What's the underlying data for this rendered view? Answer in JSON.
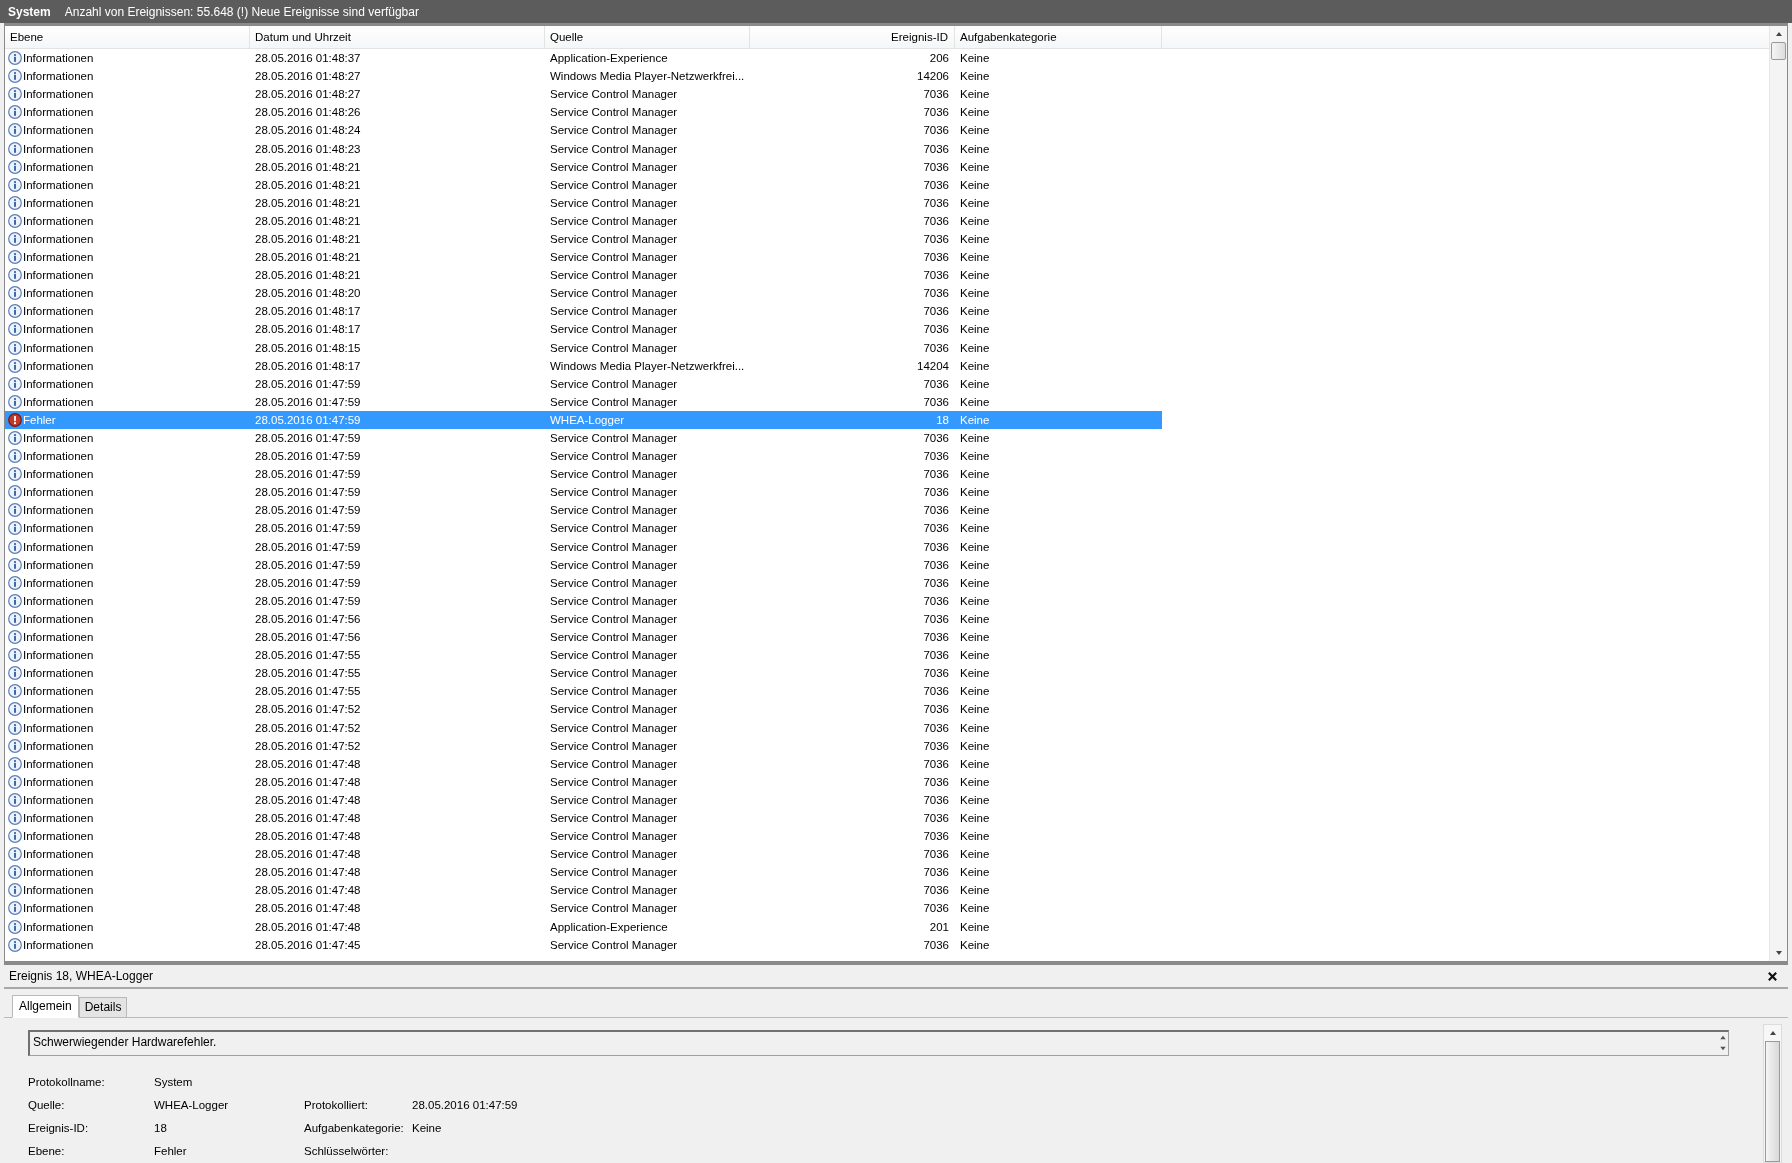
{
  "title_bar": {
    "log_name": "System",
    "status": "Anzahl von Ereignissen: 55.648 (!) Neue Ereignisse sind verfügbar"
  },
  "table": {
    "columns": [
      "Ebene",
      "Datum und Uhrzeit",
      "Quelle",
      "Ereignis-ID",
      "Aufgabenkategorie"
    ],
    "rows": [
      {
        "kind": "info",
        "ebene": "Informationen",
        "date": "28.05.2016 01:48:37",
        "source": "Application-Experience",
        "id": "206",
        "category": "Keine",
        "selected": false
      },
      {
        "kind": "info",
        "ebene": "Informationen",
        "date": "28.05.2016 01:48:27",
        "source": "Windows Media Player-Netzwerkfrei...",
        "id": "14206",
        "category": "Keine",
        "selected": false
      },
      {
        "kind": "info",
        "ebene": "Informationen",
        "date": "28.05.2016 01:48:27",
        "source": "Service Control Manager",
        "id": "7036",
        "category": "Keine",
        "selected": false
      },
      {
        "kind": "info",
        "ebene": "Informationen",
        "date": "28.05.2016 01:48:26",
        "source": "Service Control Manager",
        "id": "7036",
        "category": "Keine",
        "selected": false
      },
      {
        "kind": "info",
        "ebene": "Informationen",
        "date": "28.05.2016 01:48:24",
        "source": "Service Control Manager",
        "id": "7036",
        "category": "Keine",
        "selected": false
      },
      {
        "kind": "info",
        "ebene": "Informationen",
        "date": "28.05.2016 01:48:23",
        "source": "Service Control Manager",
        "id": "7036",
        "category": "Keine",
        "selected": false
      },
      {
        "kind": "info",
        "ebene": "Informationen",
        "date": "28.05.2016 01:48:21",
        "source": "Service Control Manager",
        "id": "7036",
        "category": "Keine",
        "selected": false
      },
      {
        "kind": "info",
        "ebene": "Informationen",
        "date": "28.05.2016 01:48:21",
        "source": "Service Control Manager",
        "id": "7036",
        "category": "Keine",
        "selected": false
      },
      {
        "kind": "info",
        "ebene": "Informationen",
        "date": "28.05.2016 01:48:21",
        "source": "Service Control Manager",
        "id": "7036",
        "category": "Keine",
        "selected": false
      },
      {
        "kind": "info",
        "ebene": "Informationen",
        "date": "28.05.2016 01:48:21",
        "source": "Service Control Manager",
        "id": "7036",
        "category": "Keine",
        "selected": false
      },
      {
        "kind": "info",
        "ebene": "Informationen",
        "date": "28.05.2016 01:48:21",
        "source": "Service Control Manager",
        "id": "7036",
        "category": "Keine",
        "selected": false
      },
      {
        "kind": "info",
        "ebene": "Informationen",
        "date": "28.05.2016 01:48:21",
        "source": "Service Control Manager",
        "id": "7036",
        "category": "Keine",
        "selected": false
      },
      {
        "kind": "info",
        "ebene": "Informationen",
        "date": "28.05.2016 01:48:21",
        "source": "Service Control Manager",
        "id": "7036",
        "category": "Keine",
        "selected": false
      },
      {
        "kind": "info",
        "ebene": "Informationen",
        "date": "28.05.2016 01:48:20",
        "source": "Service Control Manager",
        "id": "7036",
        "category": "Keine",
        "selected": false
      },
      {
        "kind": "info",
        "ebene": "Informationen",
        "date": "28.05.2016 01:48:17",
        "source": "Service Control Manager",
        "id": "7036",
        "category": "Keine",
        "selected": false
      },
      {
        "kind": "info",
        "ebene": "Informationen",
        "date": "28.05.2016 01:48:17",
        "source": "Service Control Manager",
        "id": "7036",
        "category": "Keine",
        "selected": false
      },
      {
        "kind": "info",
        "ebene": "Informationen",
        "date": "28.05.2016 01:48:15",
        "source": "Service Control Manager",
        "id": "7036",
        "category": "Keine",
        "selected": false
      },
      {
        "kind": "info",
        "ebene": "Informationen",
        "date": "28.05.2016 01:48:17",
        "source": "Windows Media Player-Netzwerkfrei...",
        "id": "14204",
        "category": "Keine",
        "selected": false
      },
      {
        "kind": "info",
        "ebene": "Informationen",
        "date": "28.05.2016 01:47:59",
        "source": "Service Control Manager",
        "id": "7036",
        "category": "Keine",
        "selected": false
      },
      {
        "kind": "info",
        "ebene": "Informationen",
        "date": "28.05.2016 01:47:59",
        "source": "Service Control Manager",
        "id": "7036",
        "category": "Keine",
        "selected": false
      },
      {
        "kind": "error",
        "ebene": "Fehler",
        "date": "28.05.2016 01:47:59",
        "source": "WHEA-Logger",
        "id": "18",
        "category": "Keine",
        "selected": true
      },
      {
        "kind": "info",
        "ebene": "Informationen",
        "date": "28.05.2016 01:47:59",
        "source": "Service Control Manager",
        "id": "7036",
        "category": "Keine",
        "selected": false
      },
      {
        "kind": "info",
        "ebene": "Informationen",
        "date": "28.05.2016 01:47:59",
        "source": "Service Control Manager",
        "id": "7036",
        "category": "Keine",
        "selected": false
      },
      {
        "kind": "info",
        "ebene": "Informationen",
        "date": "28.05.2016 01:47:59",
        "source": "Service Control Manager",
        "id": "7036",
        "category": "Keine",
        "selected": false
      },
      {
        "kind": "info",
        "ebene": "Informationen",
        "date": "28.05.2016 01:47:59",
        "source": "Service Control Manager",
        "id": "7036",
        "category": "Keine",
        "selected": false
      },
      {
        "kind": "info",
        "ebene": "Informationen",
        "date": "28.05.2016 01:47:59",
        "source": "Service Control Manager",
        "id": "7036",
        "category": "Keine",
        "selected": false
      },
      {
        "kind": "info",
        "ebene": "Informationen",
        "date": "28.05.2016 01:47:59",
        "source": "Service Control Manager",
        "id": "7036",
        "category": "Keine",
        "selected": false
      },
      {
        "kind": "info",
        "ebene": "Informationen",
        "date": "28.05.2016 01:47:59",
        "source": "Service Control Manager",
        "id": "7036",
        "category": "Keine",
        "selected": false
      },
      {
        "kind": "info",
        "ebene": "Informationen",
        "date": "28.05.2016 01:47:59",
        "source": "Service Control Manager",
        "id": "7036",
        "category": "Keine",
        "selected": false
      },
      {
        "kind": "info",
        "ebene": "Informationen",
        "date": "28.05.2016 01:47:59",
        "source": "Service Control Manager",
        "id": "7036",
        "category": "Keine",
        "selected": false
      },
      {
        "kind": "info",
        "ebene": "Informationen",
        "date": "28.05.2016 01:47:59",
        "source": "Service Control Manager",
        "id": "7036",
        "category": "Keine",
        "selected": false
      },
      {
        "kind": "info",
        "ebene": "Informationen",
        "date": "28.05.2016 01:47:56",
        "source": "Service Control Manager",
        "id": "7036",
        "category": "Keine",
        "selected": false
      },
      {
        "kind": "info",
        "ebene": "Informationen",
        "date": "28.05.2016 01:47:56",
        "source": "Service Control Manager",
        "id": "7036",
        "category": "Keine",
        "selected": false
      },
      {
        "kind": "info",
        "ebene": "Informationen",
        "date": "28.05.2016 01:47:55",
        "source": "Service Control Manager",
        "id": "7036",
        "category": "Keine",
        "selected": false
      },
      {
        "kind": "info",
        "ebene": "Informationen",
        "date": "28.05.2016 01:47:55",
        "source": "Service Control Manager",
        "id": "7036",
        "category": "Keine",
        "selected": false
      },
      {
        "kind": "info",
        "ebene": "Informationen",
        "date": "28.05.2016 01:47:55",
        "source": "Service Control Manager",
        "id": "7036",
        "category": "Keine",
        "selected": false
      },
      {
        "kind": "info",
        "ebene": "Informationen",
        "date": "28.05.2016 01:47:52",
        "source": "Service Control Manager",
        "id": "7036",
        "category": "Keine",
        "selected": false
      },
      {
        "kind": "info",
        "ebene": "Informationen",
        "date": "28.05.2016 01:47:52",
        "source": "Service Control Manager",
        "id": "7036",
        "category": "Keine",
        "selected": false
      },
      {
        "kind": "info",
        "ebene": "Informationen",
        "date": "28.05.2016 01:47:52",
        "source": "Service Control Manager",
        "id": "7036",
        "category": "Keine",
        "selected": false
      },
      {
        "kind": "info",
        "ebene": "Informationen",
        "date": "28.05.2016 01:47:48",
        "source": "Service Control Manager",
        "id": "7036",
        "category": "Keine",
        "selected": false
      },
      {
        "kind": "info",
        "ebene": "Informationen",
        "date": "28.05.2016 01:47:48",
        "source": "Service Control Manager",
        "id": "7036",
        "category": "Keine",
        "selected": false
      },
      {
        "kind": "info",
        "ebene": "Informationen",
        "date": "28.05.2016 01:47:48",
        "source": "Service Control Manager",
        "id": "7036",
        "category": "Keine",
        "selected": false
      },
      {
        "kind": "info",
        "ebene": "Informationen",
        "date": "28.05.2016 01:47:48",
        "source": "Service Control Manager",
        "id": "7036",
        "category": "Keine",
        "selected": false
      },
      {
        "kind": "info",
        "ebene": "Informationen",
        "date": "28.05.2016 01:47:48",
        "source": "Service Control Manager",
        "id": "7036",
        "category": "Keine",
        "selected": false
      },
      {
        "kind": "info",
        "ebene": "Informationen",
        "date": "28.05.2016 01:47:48",
        "source": "Service Control Manager",
        "id": "7036",
        "category": "Keine",
        "selected": false
      },
      {
        "kind": "info",
        "ebene": "Informationen",
        "date": "28.05.2016 01:47:48",
        "source": "Service Control Manager",
        "id": "7036",
        "category": "Keine",
        "selected": false
      },
      {
        "kind": "info",
        "ebene": "Informationen",
        "date": "28.05.2016 01:47:48",
        "source": "Service Control Manager",
        "id": "7036",
        "category": "Keine",
        "selected": false
      },
      {
        "kind": "info",
        "ebene": "Informationen",
        "date": "28.05.2016 01:47:48",
        "source": "Service Control Manager",
        "id": "7036",
        "category": "Keine",
        "selected": false
      },
      {
        "kind": "info",
        "ebene": "Informationen",
        "date": "28.05.2016 01:47:48",
        "source": "Application-Experience",
        "id": "201",
        "category": "Keine",
        "selected": false
      },
      {
        "kind": "info",
        "ebene": "Informationen",
        "date": "28.05.2016 01:47:45",
        "source": "Service Control Manager",
        "id": "7036",
        "category": "Keine",
        "selected": false
      }
    ]
  },
  "details": {
    "title": "Ereignis 18, WHEA-Logger",
    "tabs": [
      {
        "label": "Allgemein",
        "selected": true
      },
      {
        "label": "Details",
        "selected": false
      }
    ],
    "message": "Schwerwiegender Hardwarefehler.",
    "fields": [
      [
        {
          "label": "Protokollname:",
          "value": "System"
        }
      ],
      [
        {
          "label": "Quelle:",
          "value": "WHEA-Logger"
        },
        {
          "label": "Protokolliert:",
          "value": "28.05.2016 01:47:59"
        }
      ],
      [
        {
          "label": "Ereignis-ID:",
          "value": "18"
        },
        {
          "label": "Aufgabenkategorie:",
          "value": "Keine"
        }
      ],
      [
        {
          "label": "Ebene:",
          "value": "Fehler"
        },
        {
          "label": "Schlüsselwörter:"
        }
      ]
    ]
  }
}
